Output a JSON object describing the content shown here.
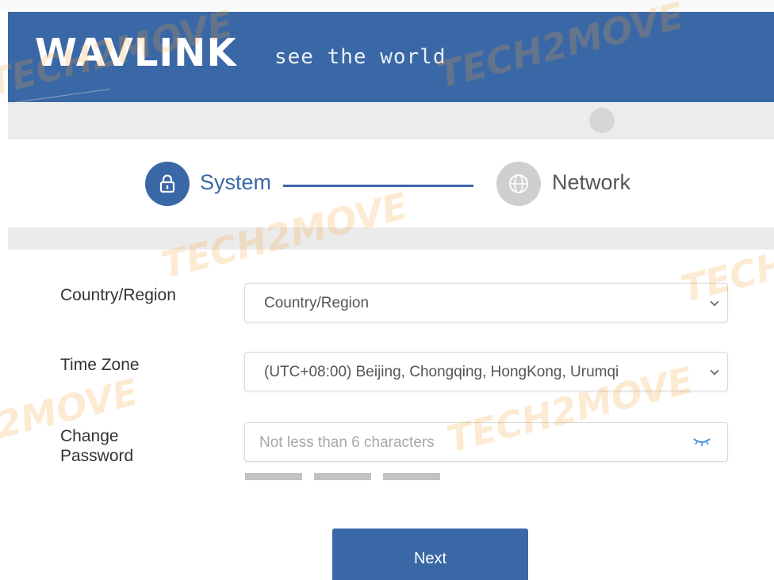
{
  "header": {
    "logo_text": "WAVLINK",
    "tagline": "see the world",
    "background_color": "#3a68a6"
  },
  "steps": [
    {
      "label": "System",
      "icon": "lock-icon",
      "state": "active"
    },
    {
      "label": "Network",
      "icon": "globe-icon",
      "state": "inactive"
    }
  ],
  "form": {
    "country": {
      "label": "Country/Region",
      "value": "Country/Region"
    },
    "timezone": {
      "label": "Time Zone",
      "value": "(UTC+08:00) Beijing, Chongqing, HongKong, Urumqi"
    },
    "password": {
      "label": "Change Password",
      "placeholder": "Not less than 6 characters",
      "value": ""
    }
  },
  "strength_meter_segments": 3,
  "next_button": {
    "label": "Next"
  },
  "watermark": "TECH2MOVE",
  "colors": {
    "accent": "#3a68a6",
    "inactive": "#cfcfcf"
  }
}
